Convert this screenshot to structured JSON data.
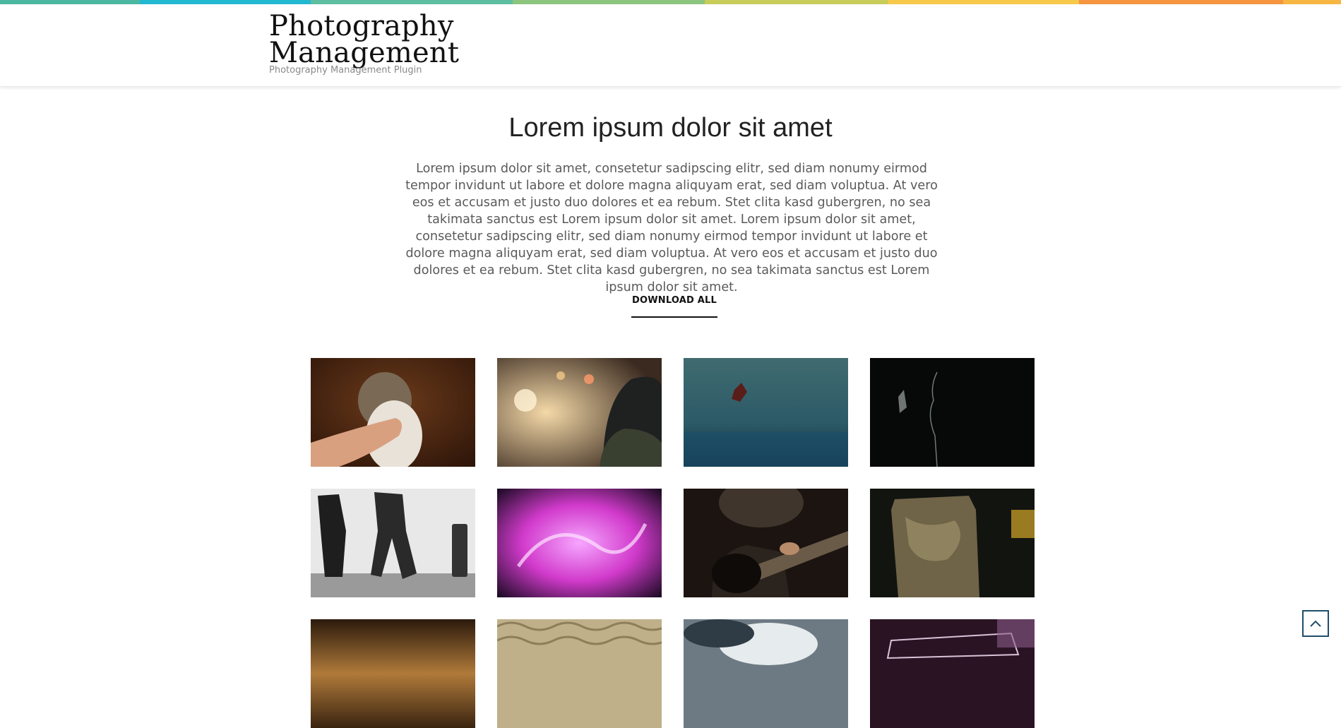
{
  "header": {
    "title_line1": "Photography",
    "title_line2": "Management",
    "tagline": "Photography Management Plugin"
  },
  "stripe_colors": [
    "#4db8a2",
    "#22b8d0",
    "#5dbfa0",
    "#8cc57e",
    "#c8cc5a",
    "#f7c94a",
    "#f59540",
    "#f7b641"
  ],
  "intro": {
    "title": "Lorem ipsum dolor sit amet",
    "text": "Lorem ipsum dolor sit amet, consetetur sadipscing elitr, sed diam nonumy eirmod tempor invidunt ut labore et dolore magna aliquyam erat, sed diam voluptua. At vero eos et accusam et justo duo dolores et ea rebum. Stet clita kasd gubergren, no sea takimata sanctus est Lorem ipsum dolor sit amet. Lorem ipsum dolor sit amet, consetetur sadipscing elitr, sed diam nonumy eirmod tempor invidunt ut labore et dolore magna aliquyam erat, sed diam voluptua. At vero eos et accusam et justo duo dolores et ea rebum. Stet clita kasd gubergren, no sea takimata sanctus est Lorem ipsum dolor sit amet.",
    "download_label": "DOWNLOAD ALL"
  },
  "gallery": {
    "photos": [
      {
        "subject": "cat-hand-photo"
      },
      {
        "subject": "bokeh-portrait-photo"
      },
      {
        "subject": "leaf-on-water-photo"
      },
      {
        "subject": "silhouette-profile-photo"
      },
      {
        "subject": "couple-suitcase-photo"
      },
      {
        "subject": "pink-light-trail-photo"
      },
      {
        "subject": "guitar-player-photo"
      },
      {
        "subject": "glass-jar-photo"
      },
      {
        "subject": "sepia-curve-photo"
      },
      {
        "subject": "woven-texture-photo"
      },
      {
        "subject": "cloudy-sky-photo"
      },
      {
        "subject": "purple-neon-photo"
      }
    ]
  },
  "scroll_top": {
    "icon": "chevron-up-icon"
  }
}
